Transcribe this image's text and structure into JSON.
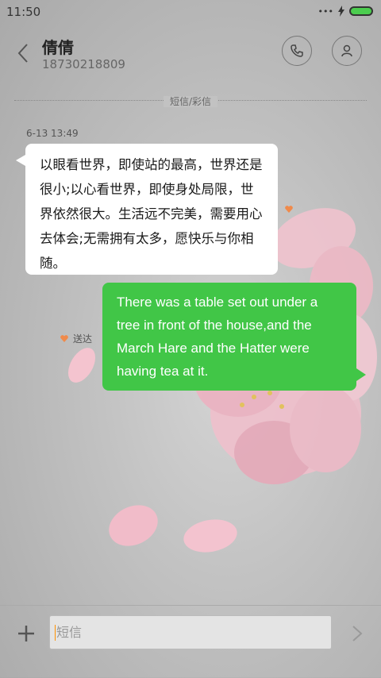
{
  "status_bar": {
    "time": "11:50"
  },
  "header": {
    "contact_name": "倩倩",
    "contact_number": "18730218809"
  },
  "divider": {
    "label": "短信/彩信"
  },
  "thread": {
    "timestamp": "6-13 13:49",
    "incoming_message": "以眼看世界，即使站的最高，世界还是很小;以心看世界，即使身处局限，世界依然很大。生活远不完美，需要用心去体会;无需拥有太多，愿快乐与你相随。",
    "outgoing_message": "There was a table set out under a tree in front of the house,and the March Hare and the Hatter were having tea at it.",
    "delivery_status": "送达"
  },
  "composer": {
    "placeholder": "短信"
  },
  "colors": {
    "outgoing_bubble": "#41c647",
    "incoming_bubble": "#ffffff",
    "accent": "#ff9100"
  },
  "icons": [
    "wifi-icon",
    "charging-icon",
    "battery-icon",
    "back-arrow-icon",
    "phone-icon",
    "person-icon",
    "heart-icon",
    "plus-icon",
    "send-arrow-icon"
  ]
}
